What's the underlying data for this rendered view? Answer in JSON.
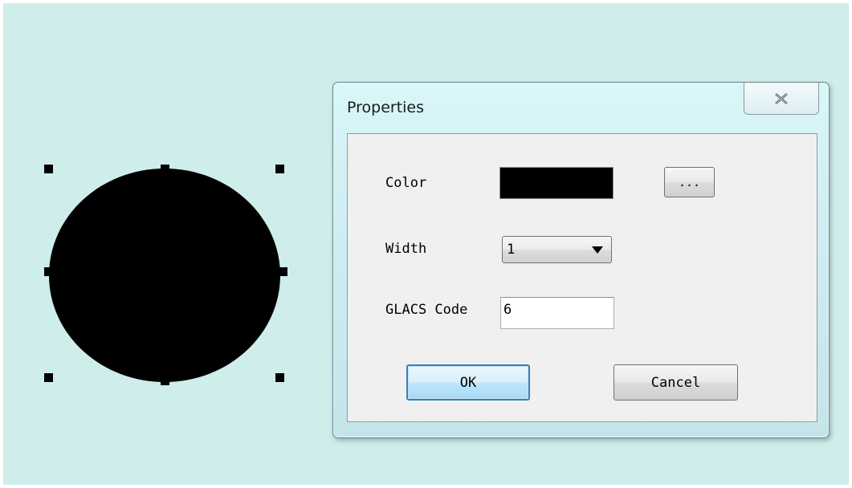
{
  "dialog": {
    "title": "Properties",
    "close_icon": "close-x-icon",
    "fields": {
      "color_label": "Color",
      "color_value": "#000000",
      "color_picker_label": "...",
      "width_label": "Width",
      "width_value": "1",
      "glacs_label": "GLACS Code",
      "glacs_value": "6"
    },
    "buttons": {
      "ok": "OK",
      "cancel": "Cancel"
    }
  },
  "canvas": {
    "background": "#ceedeb",
    "shape": {
      "type": "circle",
      "fill": "#000000",
      "selected": true
    }
  }
}
